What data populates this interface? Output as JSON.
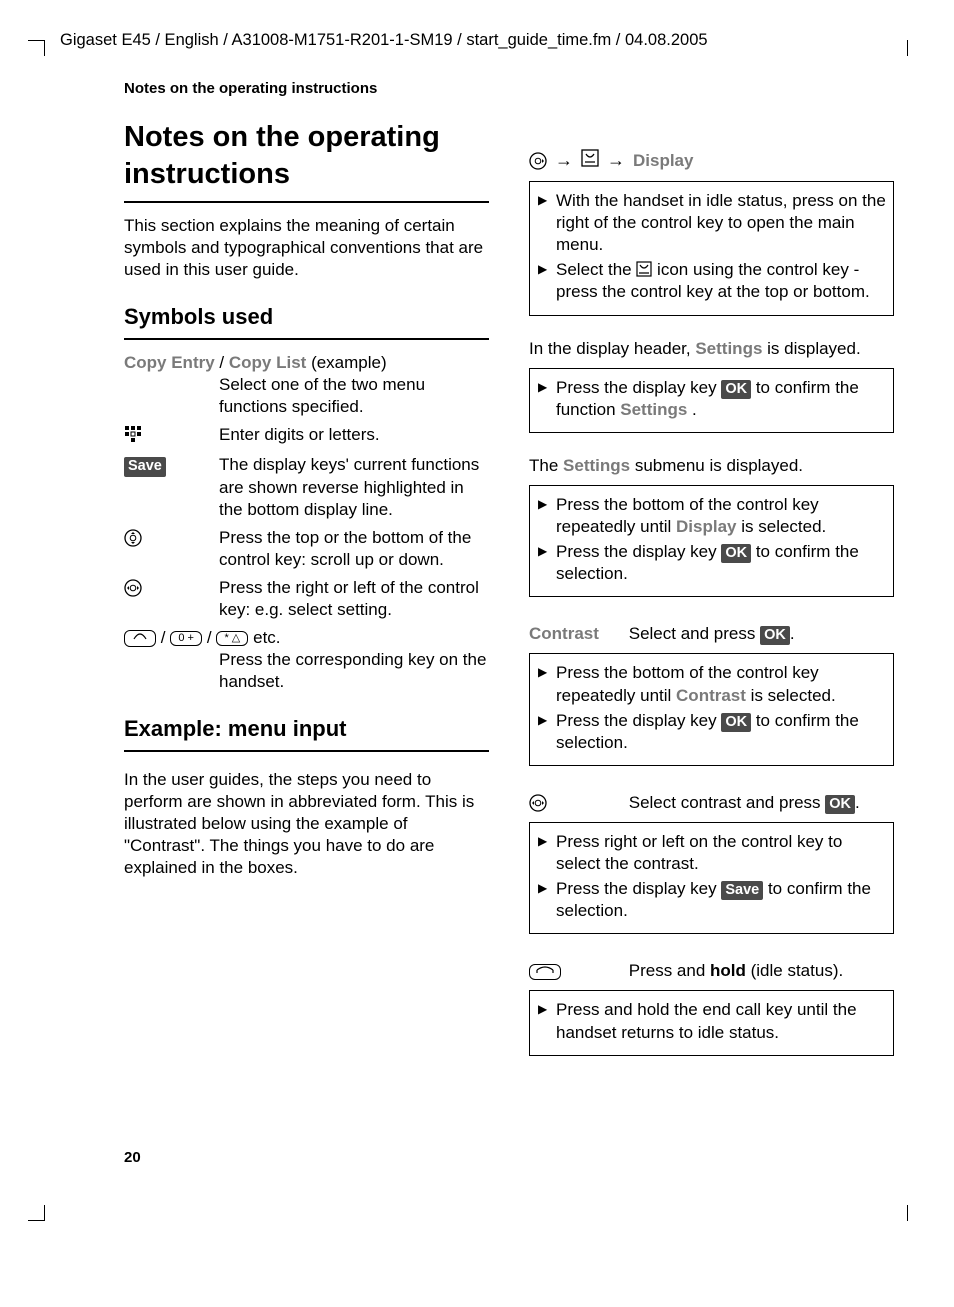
{
  "header": "Gigaset E45 / English / A31008-M1751-R201-1-SM19 / start_guide_time.fm / 04.08.2005",
  "section_label": "Notes on the operating instructions",
  "title": "Notes on the operating instructions",
  "intro": "This section explains the meaning of certain symbols and typographical conventions that are used in this user guide.",
  "symbols_heading": "Symbols used",
  "symbols": {
    "copy_entry": "Copy Entry",
    "copy_list": "Copy List",
    "example_suffix": " (example)",
    "copy_desc": "Select one of the two menu functions specified.",
    "digits_desc": "Enter digits or letters.",
    "save_label": "Save",
    "save_desc": "The display keys' current functions are shown reverse highlighted in the bottom display line.",
    "updown_desc": "Press the top or the bottom of the control key: scroll up or down.",
    "leftright_desc": "Press the right or left of the control key: e.g. select setting.",
    "keys_etc": " etc.",
    "keys_desc": "Press the corresponding key on the handset."
  },
  "example_heading": "Example: menu input",
  "example_intro": "In the user guides, the steps you need to perform are shown in abbreviated form. This is illustrated below using the example of \"Contrast\". The things you have to do are explained in the boxes.",
  "right": {
    "display_label": "Display",
    "box1_a": "With the handset in idle status, press on the right of the control key to open the main menu.",
    "box1_b_pre": "Select the ",
    "box1_b_post": " icon using the control key - press the control key at the top or bottom.",
    "line2_pre": "In the display header, ",
    "settings_label": "Settings",
    "line2_post": " is displayed.",
    "box2_a_pre": "Press the display key ",
    "ok_label": "OK",
    "box2_a_post": " to confirm the function ",
    "box2_a_end": " .",
    "line3_pre": "The ",
    "line3_post": " submenu is displayed.",
    "box3_a_pre": "Press the bottom of the control key repeatedly until ",
    "box3_a_post": " is selected.",
    "box3_b_pre": "Press the display key ",
    "box3_b_post": " to confirm the selection.",
    "contrast_label": "Contrast",
    "contrast_line": "Select and press ",
    "box4_a_pre": "Press the bottom of the control key repeatedly until ",
    "box4_a_post": " is selected.",
    "box4_b_pre": "Press the display key ",
    "box4_b_post": " to confirm the selection.",
    "select_contrast": "Select contrast and press ",
    "box5_a": "Press right or left on the control key to select the contrast.",
    "box5_b_pre": "Press the display key ",
    "box5_b_post": " to confirm the selection.",
    "hold_pre": "Press and ",
    "hold_bold": "hold",
    "hold_post": " (idle status).",
    "box6": "Press and hold the end call key until the handset returns to idle status."
  },
  "page_number": "20"
}
